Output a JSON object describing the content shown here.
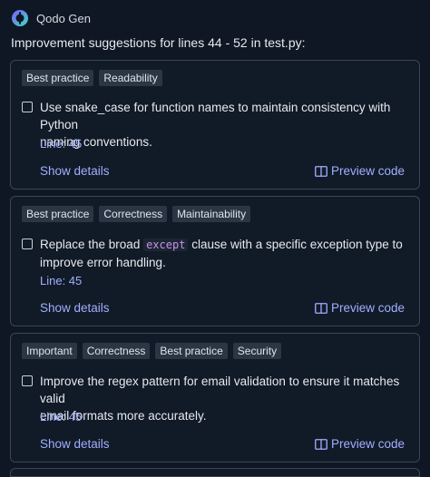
{
  "header": {
    "app_name": "Qodo Gen"
  },
  "subtitle": "Improvement suggestions for lines 44 - 52 in test.py:",
  "cards": [
    {
      "tags": [
        "Best practice",
        "Readability"
      ],
      "desc_line1": "Use snake_case for function names to maintain consistency with Python",
      "desc_line2": "naming conventions.",
      "line": "Line: 45",
      "show_details": "Show details",
      "preview_code": "Preview code"
    },
    {
      "tags": [
        "Best practice",
        "Correctness",
        "Maintainability"
      ],
      "desc_pre": "Replace the broad ",
      "desc_code": "except",
      "desc_post": " clause with a specific exception type to",
      "desc_line2": "improve error handling.",
      "line": "Line: 45",
      "show_details": "Show details",
      "preview_code": "Preview code"
    },
    {
      "tags": [
        "Important",
        "Correctness",
        "Best practice",
        "Security"
      ],
      "desc_line1": "Improve the regex pattern for email validation to ensure it matches valid",
      "desc_line2": "email formats more accurately.",
      "line": "Line: 45",
      "show_details": "Show details",
      "preview_code": "Preview code"
    }
  ],
  "colors": {
    "background": "#0f1724",
    "card_border": "#3a4656",
    "link": "#9fb0ff",
    "tag_bg": "#2b3644",
    "code": "#c792ea"
  },
  "icons": {
    "logo": "qodo-logo-icon",
    "preview": "book-icon"
  }
}
